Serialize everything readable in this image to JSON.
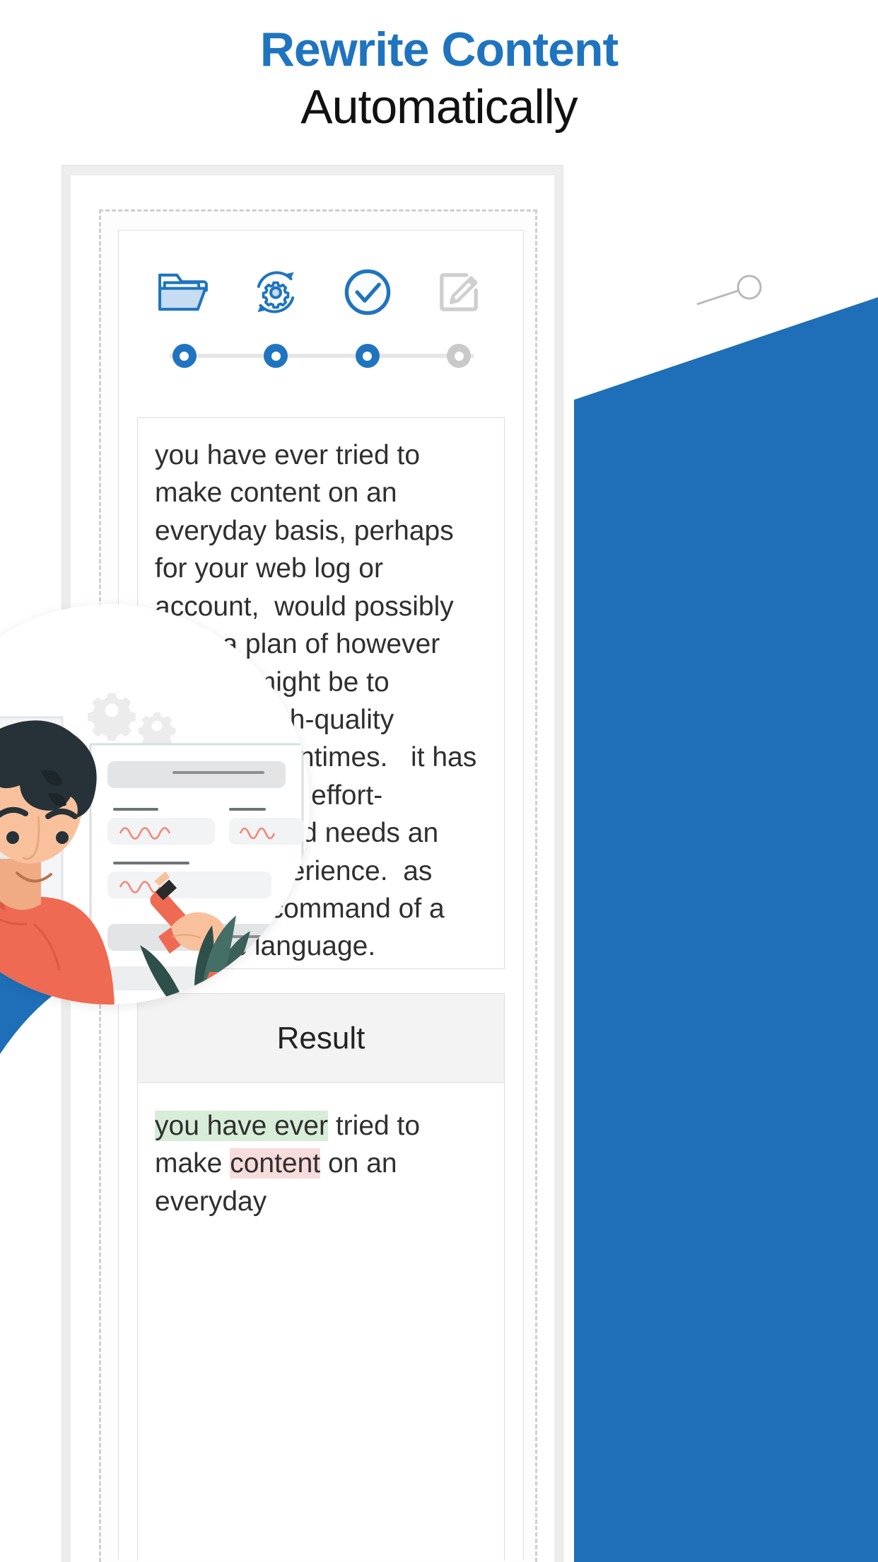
{
  "header": {
    "title_line1": "Rewrite Content",
    "title_line2": "Automatically",
    "accent_color": "#1f74bf",
    "title_color_secondary": "#111111"
  },
  "stepper": {
    "steps": [
      {
        "icon": "open-folder-icon",
        "state": "done"
      },
      {
        "icon": "gear-refresh-icon",
        "state": "done"
      },
      {
        "icon": "check-circle-icon",
        "state": "active"
      },
      {
        "icon": "edit-document-icon",
        "state": "pending"
      }
    ],
    "active_color": "#1f74bf",
    "pending_color": "#c9c9c9",
    "track_color": "#e6e6e6"
  },
  "source": {
    "text": "you have ever tried to make content on an everyday basis, perhaps for your web log or account,  would possibly have a plan of however   tough it might be to provide high-quality content oftentimes.   it has long-lasting, effort-intensive and needs an honest experience.  as well as a command of a specific language."
  },
  "result": {
    "title": "Result",
    "segments": [
      {
        "text": "you have ever",
        "highlight": "green"
      },
      {
        "text": " tried to make ",
        "highlight": "none"
      },
      {
        "text": "content",
        "highlight": "pink"
      },
      {
        "text": " on an everyday",
        "highlight": "none"
      }
    ],
    "highlight_green": "#d8edd8",
    "highlight_pink": "#f7dcdc"
  },
  "illustration": {
    "name": "man-proofreading-document-illustration",
    "shirt_color": "#ef6a52",
    "skin_color": "#f9c19b",
    "hair_color": "#263238",
    "pencil_color": "#ef6a52",
    "squiggle_color": "#f08878"
  },
  "background": {
    "blue": "#1f6fb8",
    "card_frame": "#ededed",
    "dashed_border": "#cfcfcf"
  }
}
